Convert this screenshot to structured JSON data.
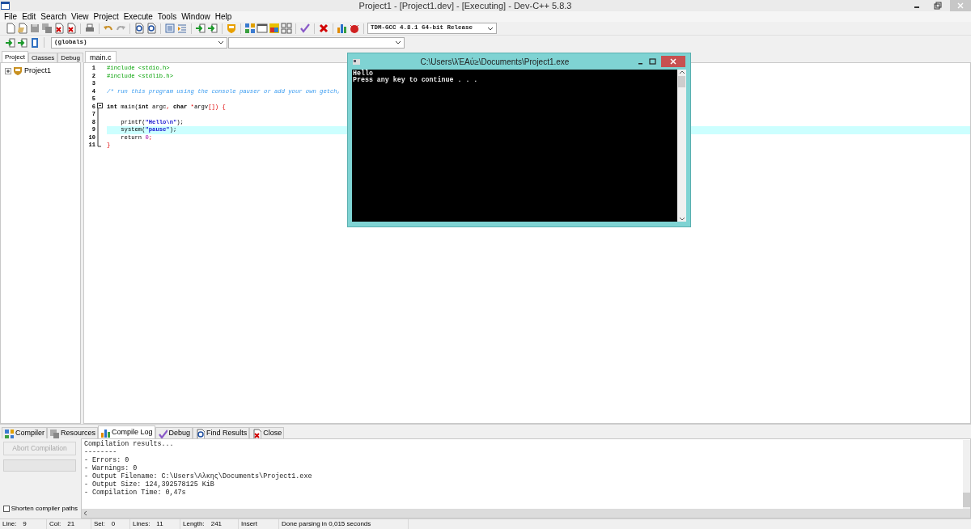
{
  "window": {
    "title": "Project1 - [Project1.dev] - [Executing] - Dev-C++ 5.8.3"
  },
  "menu": [
    "File",
    "Edit",
    "Search",
    "View",
    "Project",
    "Execute",
    "Tools",
    "Window",
    "Help"
  ],
  "toolbar": {
    "compiler": "TDM-GCC 4.8.1 64-bit Release",
    "scope": "(globals)"
  },
  "left_panel": {
    "tabs": [
      {
        "label": "Project",
        "selected": true
      },
      {
        "label": "Classes",
        "selected": false
      },
      {
        "label": "Debug",
        "selected": false
      }
    ],
    "tree": [
      {
        "label": "Project1",
        "expanded": false
      }
    ]
  },
  "editor": {
    "tabs": [
      {
        "label": "main.c",
        "selected": true
      }
    ],
    "lines": [
      {
        "number": "1",
        "selected": false,
        "tokens": [
          {
            "kind": "pre",
            "text": "#include <stdio.h>"
          }
        ]
      },
      {
        "number": "2",
        "selected": false,
        "tokens": [
          {
            "kind": "pre",
            "text": "#include <stdlib.h>"
          }
        ]
      },
      {
        "number": "3",
        "selected": false
      },
      {
        "number": "4",
        "selected": false,
        "tokens": [
          {
            "kind": "comment",
            "text": "/* run this program using the console pauser or add your own getch,"
          }
        ]
      },
      {
        "number": "5",
        "selected": false
      },
      {
        "number": "6",
        "selected": false,
        "tokens": [
          {
            "kind": "keyword",
            "text": "int"
          },
          {
            "kind": "plain",
            "text": " main("
          },
          {
            "kind": "keyword",
            "text": "int"
          },
          {
            "kind": "plain",
            "text": " argc"
          },
          {
            "kind": "symbol",
            "text": ","
          },
          {
            "kind": "keyword",
            "text": " char"
          },
          {
            "kind": "symbol",
            "text": " *"
          },
          {
            "kind": "plain",
            "text": "argv"
          },
          {
            "kind": "symbol",
            "text": "[]) {"
          }
        ]
      },
      {
        "number": "7",
        "selected": false
      },
      {
        "number": "8",
        "selected": false,
        "tokens": [
          {
            "kind": "plain",
            "text": "    printf("
          },
          {
            "kind": "string",
            "text": "\"Hello\\n\""
          },
          {
            "kind": "plain",
            "text": ");"
          }
        ]
      },
      {
        "number": "9",
        "selected": true,
        "tokens": [
          {
            "kind": "plain",
            "text": "    system("
          },
          {
            "kind": "string",
            "text": "\"pause\""
          },
          {
            "kind": "plain",
            "text": ");"
          }
        ]
      },
      {
        "number": "10",
        "selected": false,
        "tokens": [
          {
            "kind": "plain",
            "text": "    return "
          },
          {
            "kind": "number",
            "text": "0"
          },
          {
            "kind": "symbol",
            "text": ";"
          }
        ]
      },
      {
        "number": "11",
        "selected": false,
        "tokens": [
          {
            "kind": "symbol",
            "text": "}"
          }
        ]
      }
    ]
  },
  "console": {
    "title": "C:\\Users\\λΈΑύ≥\\Documents\\Project1.exe",
    "output": [
      "Hello",
      "Press any key to continue . . ."
    ]
  },
  "bottom_panel": {
    "tabs": [
      {
        "label": "Compiler",
        "selected": false
      },
      {
        "label": "Resources",
        "selected": false
      },
      {
        "label": "Compile Log",
        "selected": true
      },
      {
        "label": "Debug",
        "selected": false
      },
      {
        "label": "Find Results",
        "selected": false
      },
      {
        "label": "Close",
        "selected": false
      }
    ],
    "abort_button": {
      "label": "Abort Compilation",
      "disabled": true
    },
    "progress": {
      "level": 0
    },
    "shorten_paths": {
      "label": "Shorten compiler paths",
      "checked": false
    },
    "log": [
      "Compilation results...",
      "--------",
      "- Errors: 0",
      "- Warnings: 0",
      "- Output Filename: C:\\Users\\Αλκης\\Documents\\Project1.exe",
      "- Output Size: 124,392578125 KiB",
      "- Compilation Time: 0,47s"
    ]
  },
  "status_bar": [
    {
      "label": "Line:",
      "value": "9"
    },
    {
      "label": "Col:",
      "value": "21"
    },
    {
      "label": "Sel:",
      "value": "0"
    },
    {
      "label": "Lines:",
      "value": "11"
    },
    {
      "label": "Length:",
      "value": "241"
    },
    {
      "value": "Insert"
    },
    {
      "value": "Done parsing in 0,015 seconds"
    }
  ]
}
